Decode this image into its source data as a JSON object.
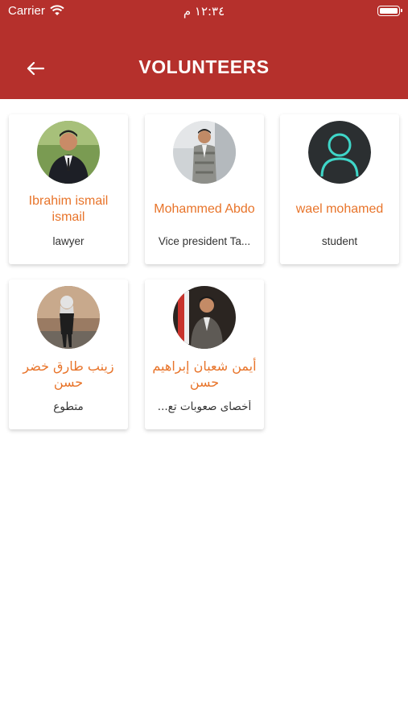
{
  "status_bar": {
    "carrier": "Carrier",
    "time": "١٢:٣٤ م"
  },
  "header": {
    "title": "VOLUNTEERS",
    "back_icon": "arrow-left-icon",
    "background_color": "#b5302c"
  },
  "accent_color": "#e8742a",
  "volunteers": [
    {
      "name": "Ibrahim ismail ismail",
      "job": "lawyer",
      "avatar": "photo"
    },
    {
      "name": "Mohammed Abdo",
      "job": "Vice president Ta...",
      "avatar": "photo"
    },
    {
      "name": "wael mohamed",
      "job": "student",
      "avatar": "default-user-icon"
    },
    {
      "name": "زينب طارق خضر حسن",
      "job": "متطوع",
      "avatar": "photo"
    },
    {
      "name": "أيمن شعبان إبراهيم حسن",
      "job": "أخصاى صعوبات تع...",
      "avatar": "photo"
    }
  ]
}
